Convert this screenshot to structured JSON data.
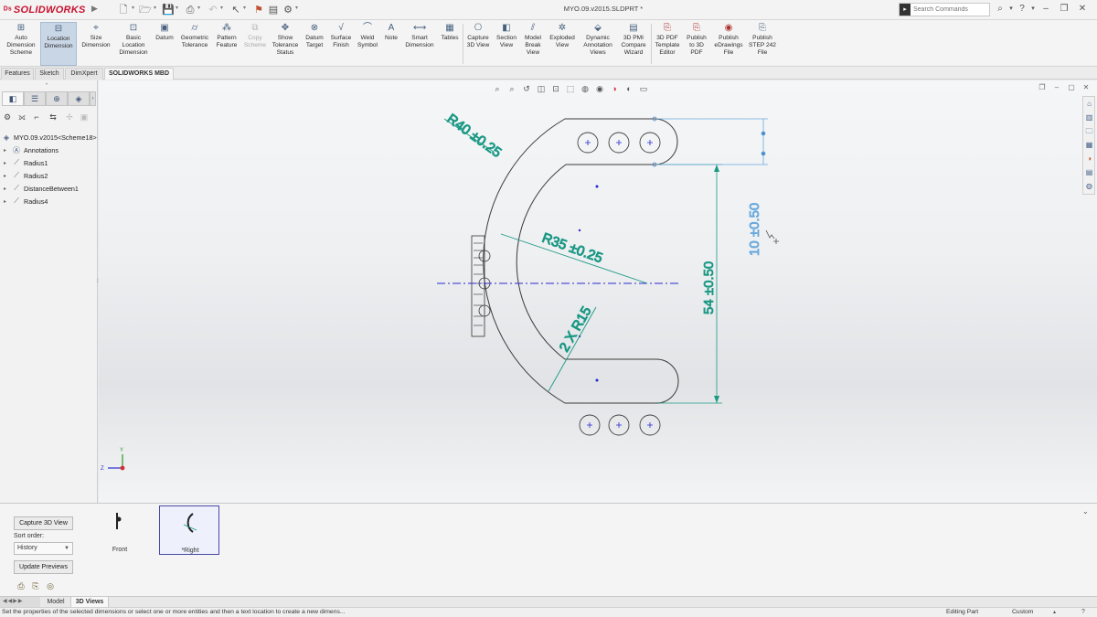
{
  "app": {
    "logo_text": "SOLIDWORKS",
    "document_title": "MYO.09.v2015.SLDPRT *"
  },
  "search": {
    "placeholder": "Search Commands"
  },
  "command_manager": {
    "items": [
      {
        "label": "Auto\nDimension\nScheme",
        "icon": "auto-dimension-icon"
      },
      {
        "label": "Location\nDimension",
        "icon": "location-dimension-icon",
        "active": true
      },
      {
        "label": "Size\nDimension",
        "icon": "size-dimension-icon"
      },
      {
        "label": "Basic\nLocation\nDimension",
        "icon": "basic-location-dimension-icon"
      },
      {
        "label": "Datum",
        "icon": "datum-icon"
      },
      {
        "label": "Geometric\nTolerance",
        "icon": "geometric-tolerance-icon"
      },
      {
        "label": "Pattern\nFeature",
        "icon": "pattern-feature-icon"
      },
      {
        "label": "Copy\nScheme",
        "icon": "copy-scheme-icon",
        "disabled": true
      },
      {
        "label": "Show\nTolerance\nStatus",
        "icon": "tolerance-status-icon"
      },
      {
        "label": "Datum\nTarget",
        "icon": "datum-target-icon"
      },
      {
        "label": "Surface\nFinish",
        "icon": "surface-finish-icon"
      },
      {
        "label": "Weld\nSymbol",
        "icon": "weld-symbol-icon"
      },
      {
        "label": "Note",
        "icon": "note-icon"
      },
      {
        "label": "Smart\nDimension",
        "icon": "smart-dimension-icon"
      },
      {
        "label": "Tables",
        "icon": "tables-icon"
      },
      {
        "label": "Capture\n3D View",
        "icon": "capture-3d-view-icon"
      },
      {
        "label": "Section\nView",
        "icon": "section-view-icon"
      },
      {
        "label": "Model\nBreak\nView",
        "icon": "model-break-view-icon"
      },
      {
        "label": "Exploded\nView",
        "icon": "exploded-view-icon"
      },
      {
        "label": "Dynamic\nAnnotation\nViews",
        "icon": "dynamic-annotation-views-icon"
      },
      {
        "label": "3D PMI\nCompare\nWizard",
        "icon": "pmi-compare-icon"
      },
      {
        "label": "3D PDF\nTemplate\nEditor",
        "icon": "pdf-template-icon"
      },
      {
        "label": "Publish\nto 3D\nPDF",
        "icon": "publish-3d-pdf-icon"
      },
      {
        "label": "Publish\neDrawings\nFile",
        "icon": "publish-edrawings-icon"
      },
      {
        "label": "Publish\nSTEP 242\nFile",
        "icon": "publish-step-icon"
      }
    ]
  },
  "cm_tabs": [
    "Features",
    "Sketch",
    "DimXpert",
    "SOLIDWORKS MBD"
  ],
  "feature_tree": {
    "root": "MYO.09.v2015<Scheme18>",
    "items": [
      "Annotations",
      "Radius1",
      "Radius2",
      "DistanceBetween1",
      "Radius4"
    ]
  },
  "dimensions": {
    "r40": "R40 ±0.25",
    "r35": "R35 ±0.25",
    "r15": "2 X R15",
    "d54": "54 ±0.50",
    "d10": "10 ±0.50"
  },
  "bottom_panel": {
    "capture_label": "Capture 3D View",
    "sort_label": "Sort order:",
    "sort_value": "History",
    "update_label": "Update Previews",
    "views": [
      {
        "label": "Front",
        "selected": false
      },
      {
        "label": "*Right",
        "selected": true
      }
    ]
  },
  "bottom_tabs": [
    "Model",
    "3D Views"
  ],
  "status": {
    "message": "Set the properties of the selected dimensions or select one or more entities and then a text location to create a new dimens...",
    "mode": "Editing Part",
    "units": "Custom"
  },
  "colors": {
    "dimension": "#1a9884",
    "selected_dimension": "#69a9dd",
    "centerline": "#2a2ad0",
    "brand": "#c8102e"
  }
}
